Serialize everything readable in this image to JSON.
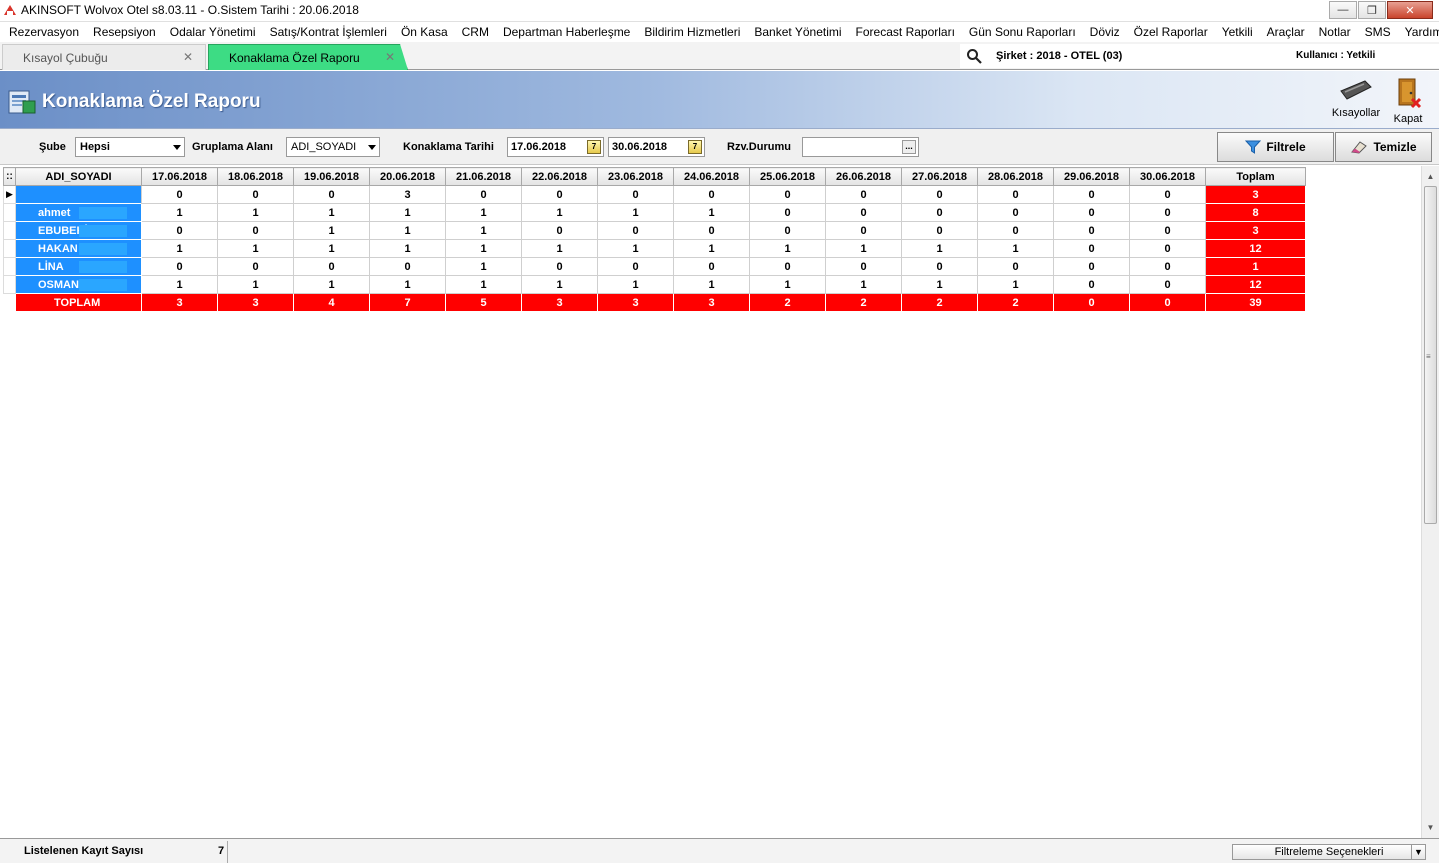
{
  "window": {
    "title": "AKINSOFT Wolvox Otel s8.03.11 - O.Sistem Tarihi : 20.06.2018"
  },
  "menu": [
    "Rezervasyon",
    "Resepsiyon",
    "Odalar Yönetimi",
    "Satış/Kontrat İşlemleri",
    "Ön Kasa",
    "CRM",
    "Departman Haberleşme",
    "Bildirim Hizmetleri",
    "Banket Yönetimi",
    "Forecast Raporları",
    "Gün Sonu Raporları",
    "Döviz",
    "Özel Raporlar",
    "Yetkili",
    "Araçlar",
    "Notlar",
    "SMS",
    "Yardım"
  ],
  "tabs": [
    {
      "label": "Kısayol Çubuğu",
      "active": false
    },
    {
      "label": "Konaklama Özel Raporu",
      "active": true
    }
  ],
  "company": "Şirket : 2018 - OTEL (03)",
  "user": "Kullanıcı : Yetkili",
  "header": {
    "title": "Konaklama Özel Raporu",
    "shortcuts_label": "Kısayollar",
    "close_label": "Kapat"
  },
  "filters": {
    "sube_label": "Şube",
    "sube_value": "Hepsi",
    "grup_label": "Gruplama Alanı",
    "grup_value": "ADI_SOYADI",
    "tarih_label": "Konaklama Tarihi",
    "date_from": "17.06.2018",
    "date_to": "30.06.2018",
    "rzv_label": "Rzv.Durumu",
    "rzv_value": "",
    "filter_button": "Filtrele",
    "clear_button": "Temizle"
  },
  "grid": {
    "name_header": "ADI_SOYADI",
    "dates": [
      "17.06.2018",
      "18.06.2018",
      "19.06.2018",
      "20.06.2018",
      "21.06.2018",
      "22.06.2018",
      "23.06.2018",
      "24.06.2018",
      "25.06.2018",
      "26.06.2018",
      "27.06.2018",
      "28.06.2018",
      "29.06.2018",
      "30.06.2018"
    ],
    "total_header": "Toplam",
    "rows": [
      {
        "name": "",
        "values": [
          "0",
          "0",
          "0",
          "3",
          "0",
          "0",
          "0",
          "0",
          "0",
          "0",
          "0",
          "0",
          "0",
          "0"
        ],
        "total": "3"
      },
      {
        "name": "ahmet",
        "values": [
          "1",
          "1",
          "1",
          "1",
          "1",
          "1",
          "1",
          "1",
          "0",
          "0",
          "0",
          "0",
          "0",
          "0"
        ],
        "total": "8"
      },
      {
        "name": "EBUBEKİR",
        "values": [
          "0",
          "0",
          "1",
          "1",
          "1",
          "0",
          "0",
          "0",
          "0",
          "0",
          "0",
          "0",
          "0",
          "0"
        ],
        "total": "3"
      },
      {
        "name": "HAKAN",
        "values": [
          "1",
          "1",
          "1",
          "1",
          "1",
          "1",
          "1",
          "1",
          "1",
          "1",
          "1",
          "1",
          "0",
          "0"
        ],
        "total": "12"
      },
      {
        "name": "LİNA",
        "values": [
          "0",
          "0",
          "0",
          "0",
          "1",
          "0",
          "0",
          "0",
          "0",
          "0",
          "0",
          "0",
          "0",
          "0"
        ],
        "total": "1"
      },
      {
        "name": "OSMAN",
        "values": [
          "1",
          "1",
          "1",
          "1",
          "1",
          "1",
          "1",
          "1",
          "1",
          "1",
          "1",
          "1",
          "0",
          "0"
        ],
        "total": "12"
      }
    ],
    "total_row": {
      "name": "TOPLAM",
      "values": [
        "3",
        "3",
        "4",
        "7",
        "5",
        "3",
        "3",
        "3",
        "2",
        "2",
        "2",
        "2",
        "0",
        "0"
      ],
      "total": "39"
    }
  },
  "status": {
    "count_label": "Listelenen Kayıt Sayısı",
    "count": "7",
    "filter_options": "Filtreleme Seçenekleri"
  }
}
